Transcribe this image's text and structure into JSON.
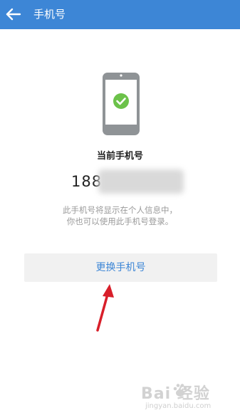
{
  "colors": {
    "header_bg": "#3d86d6",
    "accent": "#3d86d6",
    "check_green": "#6cc24a",
    "arrow_red": "#d81f2a"
  },
  "header": {
    "back_icon": "arrow-left-icon",
    "title": "手机号"
  },
  "illustration": {
    "icon": "phone-check-icon"
  },
  "current": {
    "label": "当前手机号",
    "number_visible": "188"
  },
  "description": {
    "line1": "此手机号将显示在个人信息中，",
    "line2": "你也可以使用此手机号登录。"
  },
  "actions": {
    "change_label": "更换手机号"
  },
  "watermark": {
    "brand": "Bai  经验",
    "url": "jingyan.baidu.com"
  }
}
